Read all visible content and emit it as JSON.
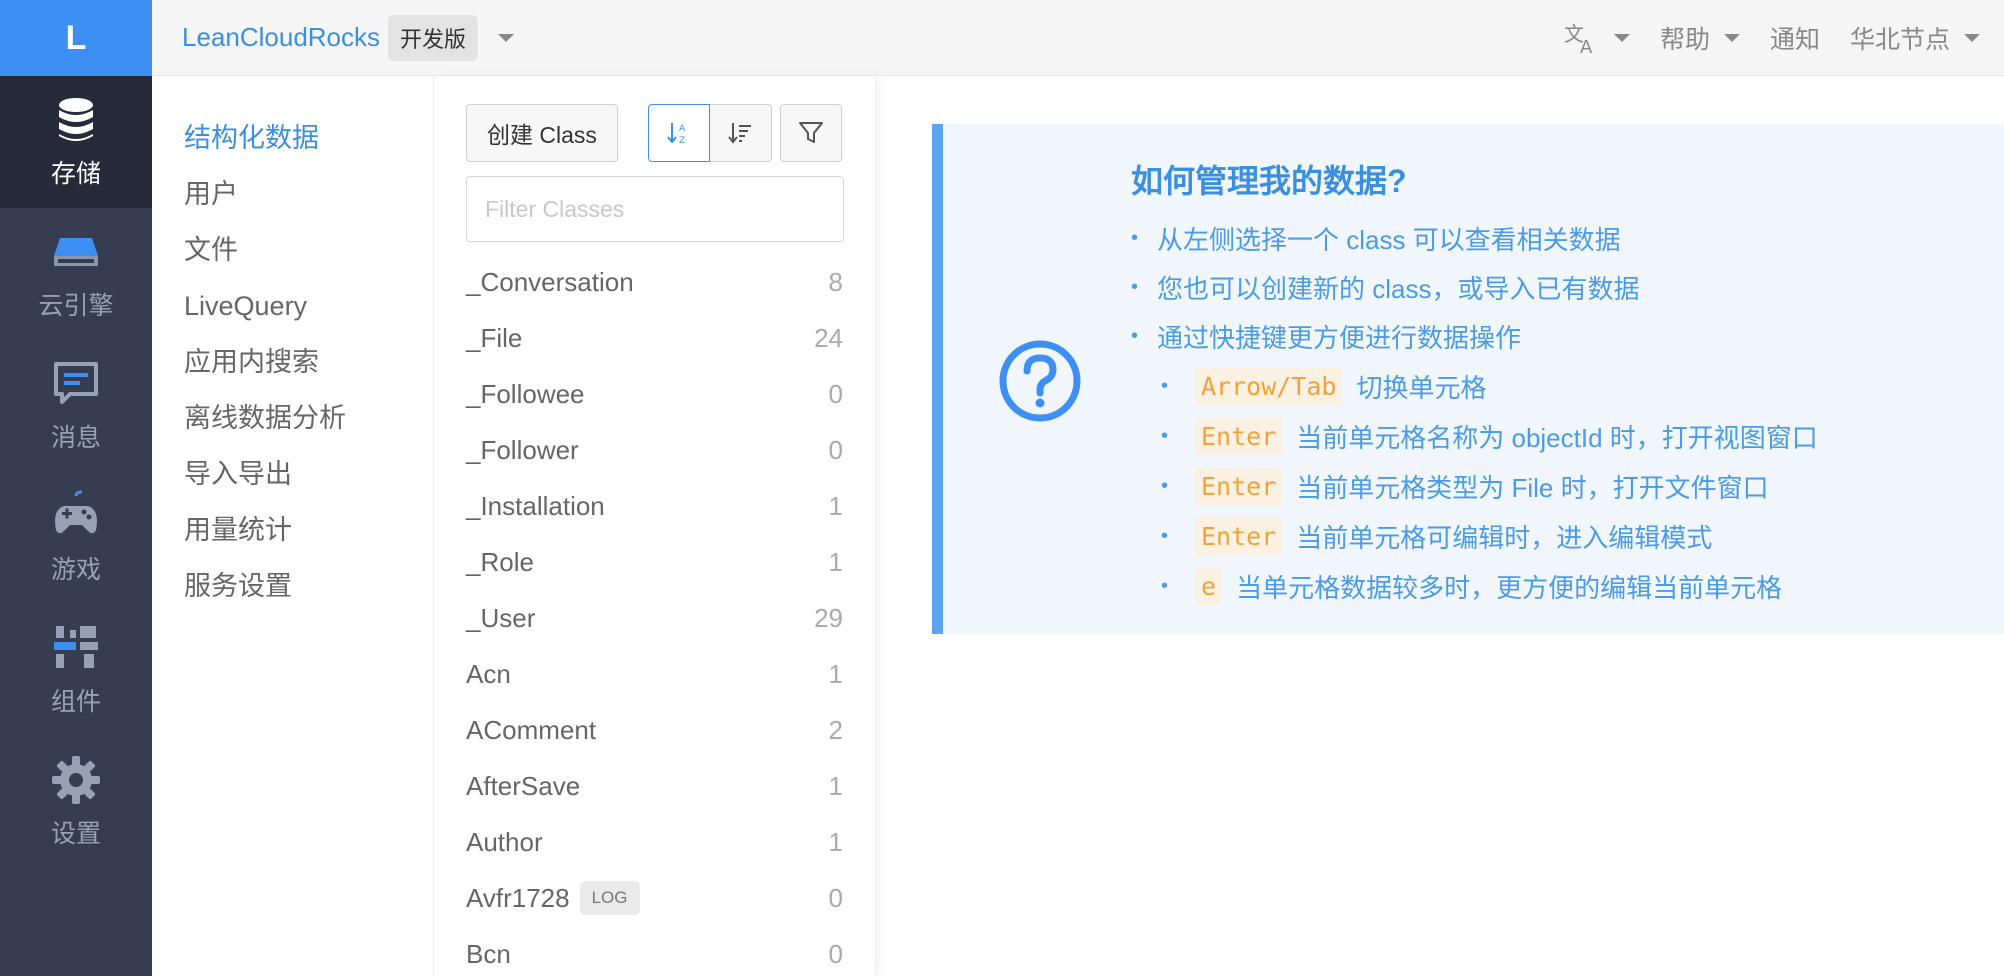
{
  "rail": {
    "logo": "L",
    "items": [
      {
        "label": "存储",
        "icon": "database-icon"
      },
      {
        "label": "云引擎",
        "icon": "server-icon"
      },
      {
        "label": "消息",
        "icon": "chat-icon"
      },
      {
        "label": "游戏",
        "icon": "gamepad-icon"
      },
      {
        "label": "组件",
        "icon": "components-icon"
      },
      {
        "label": "设置",
        "icon": "gear-icon"
      }
    ]
  },
  "topbar": {
    "app_name": "LeanCloudRocks",
    "edition": "开发版",
    "language_icon": "translate-icon",
    "help": "帮助",
    "notify": "通知",
    "region": "华北节点"
  },
  "menu": {
    "items": [
      "结构化数据",
      "用户",
      "文件",
      "LiveQuery",
      "应用内搜索",
      "离线数据分析",
      "导入导出",
      "用量统计",
      "服务设置"
    ]
  },
  "classes": {
    "create_label": "创建 Class",
    "filter_placeholder": "Filter Classes",
    "rows": [
      {
        "name": "_Conversation",
        "count": "8"
      },
      {
        "name": "_File",
        "count": "24"
      },
      {
        "name": "_Followee",
        "count": "0"
      },
      {
        "name": "_Follower",
        "count": "0"
      },
      {
        "name": "_Installation",
        "count": "1"
      },
      {
        "name": "_Role",
        "count": "1"
      },
      {
        "name": "_User",
        "count": "29"
      },
      {
        "name": "Acn",
        "count": "1"
      },
      {
        "name": "AComment",
        "count": "2"
      },
      {
        "name": "AfterSave",
        "count": "1"
      },
      {
        "name": "Author",
        "count": "1"
      },
      {
        "name": "Avfr1728",
        "count": "0",
        "badge": "LOG"
      },
      {
        "name": "Bcn",
        "count": "0"
      }
    ]
  },
  "info": {
    "title": "如何管理我的数据?",
    "tips": [
      "从左侧选择一个 class 可以查看相关数据",
      "您也可以创建新的 class，或导入已有数据",
      "通过快捷键更方便进行数据操作"
    ],
    "shortcuts": [
      {
        "key": "Arrow/Tab",
        "desc": "切换单元格"
      },
      {
        "key": "Enter",
        "desc": "当前单元格名称为 objectId 时，打开视图窗口"
      },
      {
        "key": "Enter",
        "desc": "当前单元格类型为 File 时，打开文件窗口"
      },
      {
        "key": "Enter",
        "desc": "当前单元格可编辑时，进入编辑模式"
      },
      {
        "key": "e",
        "desc": "当单元格数据较多时，更方便的编辑当前单元格"
      }
    ]
  },
  "colors": {
    "accent": "#3d8ff4",
    "rail_bg": "#373d51",
    "rail_active": "#272b39",
    "key_color": "#f0a33b"
  }
}
